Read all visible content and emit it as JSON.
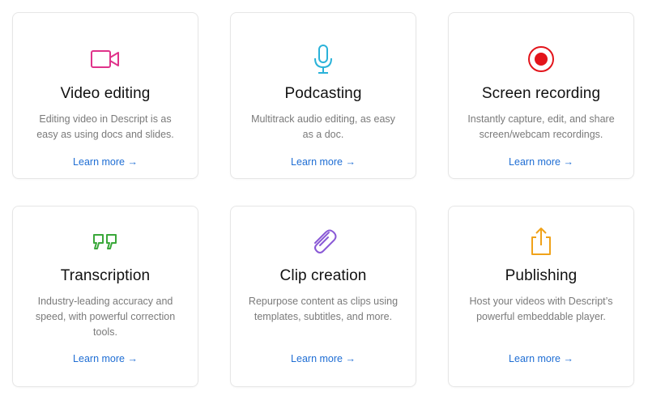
{
  "colors": {
    "video_icon": "#e0338a",
    "podcast_icon": "#2ab2d9",
    "record_icon": "#e3141b",
    "transcription_icon": "#3aa83a",
    "clip_icon": "#8a5ad6",
    "publish_icon": "#f0a21a",
    "link": "#1f6ed4"
  },
  "cards": [
    {
      "icon": "video-camera-icon",
      "title": "Video editing",
      "description": "Editing video in Descript is as easy as using docs and slides.",
      "link": "Learn more →"
    },
    {
      "icon": "microphone-icon",
      "title": "Podcasting",
      "description": "Multitrack audio editing, as easy as a doc.",
      "link": "Learn more →"
    },
    {
      "icon": "record-icon",
      "title": "Screen recording",
      "description": "Instantly capture, edit, and share screen/webcam recordings.",
      "link": "Learn more →"
    },
    {
      "icon": "quote-icon",
      "title": "Transcription",
      "description": "Industry-leading accuracy and speed, with powerful correction tools.",
      "link": "Learn more →"
    },
    {
      "icon": "paperclip-icon",
      "title": "Clip creation",
      "description": "Repurpose content as clips using templates, subtitles, and more.",
      "link": "Learn more →"
    },
    {
      "icon": "share-upload-icon",
      "title": "Publishing",
      "description": "Host your videos with Descript’s powerful embeddable player.",
      "link": "Learn more →"
    }
  ]
}
